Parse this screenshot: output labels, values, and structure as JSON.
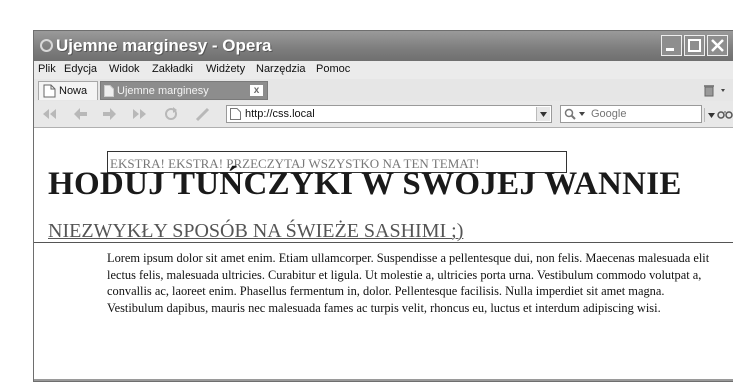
{
  "window": {
    "title": "Ujemne marginesy - Opera"
  },
  "menu": {
    "items": [
      "Plik",
      "Edycja",
      "Widok",
      "Zakładki",
      "Widżety",
      "Narzędzia",
      "Pomoc"
    ]
  },
  "tabs": {
    "new_label": "Nowa",
    "active_label": "Ujemne marginesy",
    "close_glyph": "x"
  },
  "nav": {
    "url": "http://css.local",
    "search_placeholder": "Google"
  },
  "page": {
    "kicker": "EKSTRA! EKSTRA! PRZECZYTAJ WSZYSTKO NA TEN TEMAT!",
    "headline": "HODUJ TUŃCZYKI W SWOJEJ WANNIE",
    "subheadline": "NIEZWYKŁY SPOSÓB NA ŚWIEŻE SASHIMI ;)",
    "body": "Lorem ipsum dolor sit amet enim. Etiam ullamcorper. Suspendisse a pellentesque dui, non felis. Maecenas malesuada elit lectus felis, malesuada ultricies. Curabitur et ligula. Ut molestie a, ultricies porta urna. Vestibulum commodo volutpat a, convallis ac, laoreet enim. Phasellus fermentum in, dolor. Pellentesque facilisis. Nulla imperdiet sit amet magna. Vestibulum dapibus, mauris nec malesuada fames ac turpis velit, rhoncus eu, luctus et interdum adipiscing wisi."
  },
  "colors": {
    "titlebar": "#7d7d7d",
    "active_tab": "#8d8d8d",
    "chrome": "#e8e8e8"
  }
}
